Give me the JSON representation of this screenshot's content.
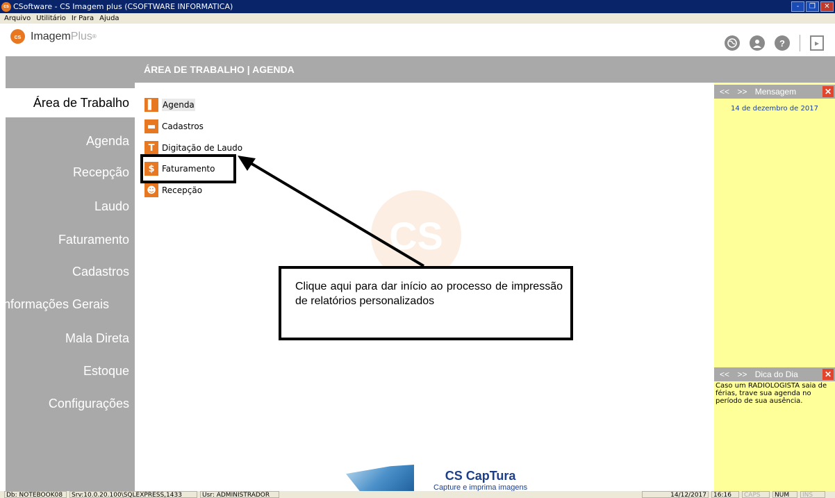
{
  "window": {
    "title": "CSoftware - CS Imagem plus (CSOFTWARE INFORMATICA)",
    "minimize": "-",
    "maximize": "❐",
    "close": "✕"
  },
  "menu": [
    "Arquivo",
    "Utilitário",
    "Ir Para",
    "Ajuda"
  ],
  "brand": {
    "logo": "cs",
    "name_part1": "Imagem",
    "name_part2": "Plus",
    "reg": "®"
  },
  "toolbar_icons": [
    "globe-icon",
    "user-icon",
    "help-icon",
    "exit-icon"
  ],
  "sidebar": {
    "items": [
      {
        "label": "Área de Trabalho",
        "active": true
      },
      {
        "label": "Agenda"
      },
      {
        "label": "Recepção"
      },
      {
        "label": "Laudo"
      },
      {
        "label": "Faturamento"
      },
      {
        "label": "Cadastros"
      },
      {
        "label": "Informações Gerais"
      },
      {
        "label": "Mala Direta"
      },
      {
        "label": "Estoque"
      },
      {
        "label": "Configurações"
      }
    ]
  },
  "header": {
    "title": "ÁREA DE TRABALHO | AGENDA"
  },
  "workspace": {
    "watermark": "CS",
    "items": [
      {
        "label": "Agenda",
        "icon": "book-icon",
        "glyph": "▌",
        "selected": true
      },
      {
        "label": "Cadastros",
        "icon": "folder-icon",
        "glyph": "▬"
      },
      {
        "label": "Digitação de Laudo",
        "icon": "text-icon",
        "glyph": "T"
      },
      {
        "label": "Faturamento",
        "icon": "dollar-icon",
        "glyph": "$"
      },
      {
        "label": "Recepção",
        "icon": "reception-icon",
        "glyph": "☻"
      }
    ]
  },
  "callout": {
    "text": "Clique aqui para dar início ao processo de impressão de relatórios personalizados"
  },
  "captura": {
    "title": "CS CapTura",
    "subtitle": "Capture e imprima imagens"
  },
  "message_panel": {
    "nav_prev": "<<",
    "nav_next": ">>",
    "title": "Mensagem",
    "date": "14 de dezembro de 2017"
  },
  "tip_panel": {
    "nav_prev": "<<",
    "nav_next": ">>",
    "title": "Dica do Dia",
    "text": "Caso um RADIOLOGISTA saia de férias, trave sua agenda no período de sua ausência."
  },
  "statusbar": {
    "db": "Db: NOTEBOOK08",
    "srv": "Srv:10.0.20.100\\SQLEXPRESS,1433",
    "usr": "Usr: ADMINISTRADOR",
    "date": "14/12/2017",
    "time": "16:16",
    "caps": "CAPS",
    "num": "NUM",
    "ins": "INS"
  },
  "colors": {
    "accent": "#e87722",
    "sidebar": "#a9a9a9",
    "panel": "#ffff99",
    "titlebar": "#0a246a"
  }
}
